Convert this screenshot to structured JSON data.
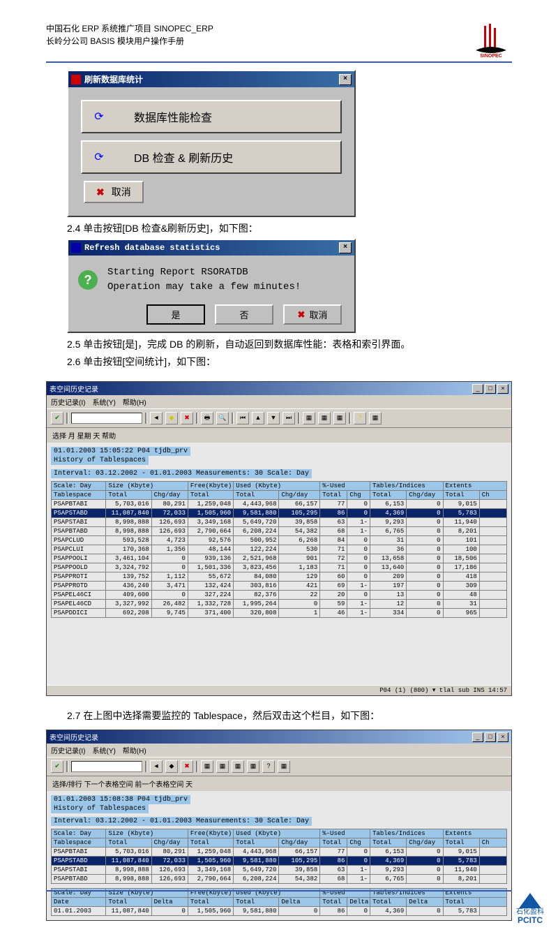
{
  "header": {
    "line1": "中国石化 ERP 系统推广项目   SINOPEC_ERP",
    "line2": "长岭分公司 BASIS 模块用户操作手册"
  },
  "dialog1": {
    "title": "刷新数据库统计",
    "btn1": "数据库性能检查",
    "btn2": "DB 检查 & 刷新历史",
    "cancel": "取消"
  },
  "step24": "2.4    单击按钮[DB 检查&刷新历史]，如下图：",
  "dialog2": {
    "title": "Refresh database statistics",
    "msg1": "Starting Report RSORATDB",
    "msg2": "Operation may take a few minutes!",
    "yes": "是",
    "no": "否",
    "cancel": "取消"
  },
  "step25": "2.5    单击按钮[是]，完成 DB 的刷新，自动返回到数据库性能：表格和索引界面。",
  "step26": "2.6    单击按钮[空间统计]，如下图：",
  "shot1": {
    "title": "表空间历史记录",
    "menu": [
      "历史记录(I)",
      "系统(Y)",
      "帮助(H)"
    ],
    "subbar": "选择   月   星期   天   帮助",
    "line1": "01.01.2003   15:05:22   P04   tjdb_prv",
    "line2": "History of Tablespaces",
    "interval": "Interval: 03.12.2002 - 01.01.2003      Measurements:    30      Scale: Day",
    "head_groups": [
      "Scale: Day",
      "Size (Kbyte)",
      "Free(Kbyte)",
      "Used (Kbyte)",
      "%-Used",
      "Tables/Indices",
      "Extents"
    ],
    "head_cols": [
      "Tablespace",
      "Total",
      "Chg/day",
      "Total",
      "Total",
      "Chg/day",
      "Total",
      "Chg",
      "Total",
      "Chg/day",
      "Total",
      "Ch"
    ],
    "rows": [
      [
        "PSAPBTABI",
        "5,703,016",
        "80,291",
        "1,259,048",
        "4,443,968",
        "66,157",
        "77",
        "0",
        "6,153",
        "0",
        "9,015",
        ""
      ],
      [
        "PSAPSTABD",
        "11,087,840",
        "72,033",
        "1,505,960",
        "9,581,880",
        "105,295",
        "86",
        "0",
        "4,369",
        "0",
        "5,783",
        ""
      ],
      [
        "PSAPSTABI",
        "8,998,888",
        "126,693",
        "3,349,168",
        "5,649,720",
        "39,858",
        "63",
        "1-",
        "9,293",
        "0",
        "11,940",
        ""
      ],
      [
        "PSAPBTABD",
        "8,998,888",
        "126,693",
        "2,790,664",
        "6,208,224",
        "54,382",
        "68",
        "1-",
        "6,765",
        "0",
        "8,201",
        ""
      ],
      [
        "PSAPCLUD",
        "593,528",
        "4,723",
        "92,576",
        "500,952",
        "6,268",
        "84",
        "0",
        "31",
        "0",
        "101",
        ""
      ],
      [
        "PSAPCLUI",
        "170,368",
        "1,356",
        "48,144",
        "122,224",
        "530",
        "71",
        "0",
        "36",
        "0",
        "100",
        ""
      ],
      [
        "PSAPPOOLI",
        "3,461,104",
        "0",
        "939,136",
        "2,521,968",
        "901",
        "72",
        "0",
        "13,658",
        "0",
        "18,506",
        ""
      ],
      [
        "PSAPPOOLD",
        "3,324,792",
        "0",
        "1,501,336",
        "3,823,456",
        "1,183",
        "71",
        "0",
        "13,640",
        "0",
        "17,186",
        ""
      ],
      [
        "PSAPPROTI",
        "139,752",
        "1,112",
        "55,672",
        "84,080",
        "129",
        "60",
        "0",
        "209",
        "0",
        "418",
        ""
      ],
      [
        "PSAPPROTD",
        "436,240",
        "3,471",
        "132,424",
        "303,816",
        "421",
        "69",
        "1-",
        "197",
        "0",
        "309",
        ""
      ],
      [
        "PSAPEL46CI",
        "409,600",
        "0",
        "327,224",
        "82,376",
        "22",
        "20",
        "0",
        "13",
        "0",
        "48",
        ""
      ],
      [
        "PSAPEL46CD",
        "3,327,992",
        "26,482",
        "1,332,728",
        "1,995,264",
        "0",
        "59",
        "1-",
        "12",
        "0",
        "31",
        ""
      ],
      [
        "PSAPDDICI",
        "692,208",
        "9,745",
        "371,400",
        "320,808",
        "1",
        "46",
        "1-",
        "334",
        "0",
        "965",
        ""
      ]
    ],
    "status": "P04 (1) (800) ▾  tlal sub   INS   14:57"
  },
  "step27": "2.7    在上图中选择需要监控的 Tablespace，然后双击这个栏目，如下图：",
  "shot2": {
    "title": "表空间历史记录",
    "menu": [
      "历史记录(I)",
      "系统(Y)",
      "帮助(H)"
    ],
    "subbar": "选择/排行   下一个表格空间   前一个表格空间   天",
    "line1": "01.01.2003   15:08:38   P04   tjdb_prv",
    "line2": "History of Tablespaces",
    "interval": "Interval: 03.12.2002 - 01.01.2003      Measurements:    30      Scale: Day",
    "rows": [
      [
        "PSAPBTABI",
        "5,703,016",
        "80,291",
        "1,259,048",
        "4,443,968",
        "66,157",
        "77",
        "0",
        "6,153",
        "0",
        "9,015",
        ""
      ],
      [
        "PSAPSTABD",
        "11,087,840",
        "72,033",
        "1,505,960",
        "9,581,880",
        "105,295",
        "86",
        "0",
        "4,369",
        "0",
        "5,783",
        ""
      ],
      [
        "PSAPSTABI",
        "8,998,888",
        "126,693",
        "3,349,168",
        "5,649,720",
        "39,858",
        "63",
        "1-",
        "9,293",
        "0",
        "11,940",
        ""
      ],
      [
        "PSAPBTABD",
        "8,998,888",
        "126,693",
        "2,790,664",
        "6,208,224",
        "54,382",
        "68",
        "1-",
        "6,765",
        "0",
        "8,201",
        ""
      ]
    ],
    "head2_groups": [
      "Scale: Day",
      "Size (Kbyte)",
      "Free(Kbyte)",
      "Used (Kbyte)",
      "%-Used",
      "Tables/Indices",
      "Extents"
    ],
    "head2_cols": [
      "Date",
      "Total",
      "Delta",
      "Total",
      "Total",
      "Delta",
      "Total",
      "Delta",
      "Total",
      "Delta",
      "Total",
      ""
    ],
    "row2": [
      "01.01.2003",
      "11,087,840",
      "0",
      "1,505,960",
      "9,581,880",
      "0",
      "86",
      "0",
      "4,369",
      "0",
      "5,783",
      ""
    ]
  },
  "pcitc": {
    "cn": "石化盈科",
    "en": "PCITC"
  }
}
